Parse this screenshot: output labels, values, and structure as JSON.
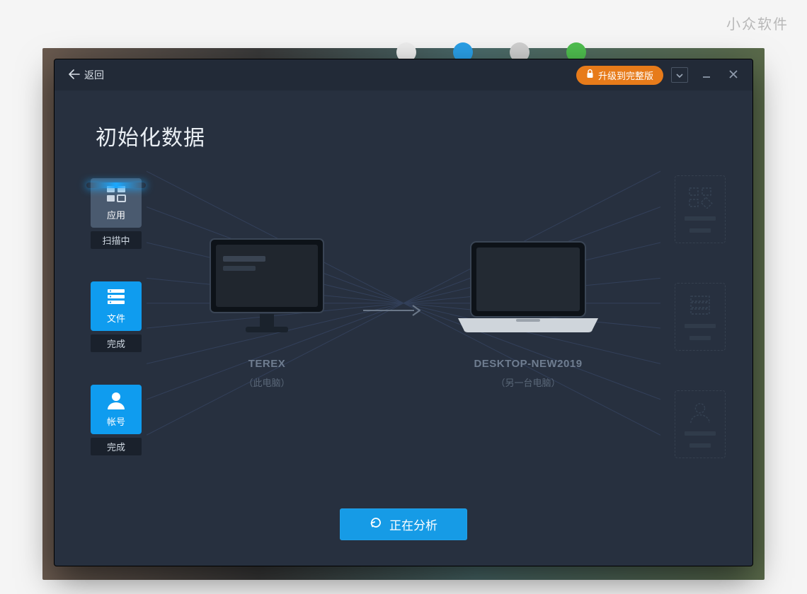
{
  "watermark": "小众软件",
  "titlebar": {
    "back_label": "返回",
    "upgrade_label": "升级到完整版"
  },
  "page": {
    "title": "初始化数据"
  },
  "categories": [
    {
      "key": "apps",
      "label": "应用",
      "status": "扫描中",
      "state": "scanning"
    },
    {
      "key": "files",
      "label": "文件",
      "status": "完成",
      "state": "done"
    },
    {
      "key": "accounts",
      "label": "帐号",
      "status": "完成",
      "state": "done"
    }
  ],
  "source_device": {
    "name": "TEREX",
    "subtitle": "（此电脑）"
  },
  "target_device": {
    "name": "DESKTOP-NEW2019",
    "subtitle": "（另一台电脑）"
  },
  "action": {
    "analyze_label": "正在分析"
  },
  "icons": {
    "back": "arrow-left-icon",
    "lock": "lock-icon",
    "dropdown": "chevron-down-icon",
    "minimize": "minimize-icon",
    "close": "close-icon",
    "apps": "apps-grid-icon",
    "files": "server-stack-icon",
    "accounts": "person-icon",
    "refresh": "refresh-icon"
  },
  "colors": {
    "accent": "#169be6",
    "upgrade": "#e77b1a",
    "window_bg": "#27303f"
  }
}
